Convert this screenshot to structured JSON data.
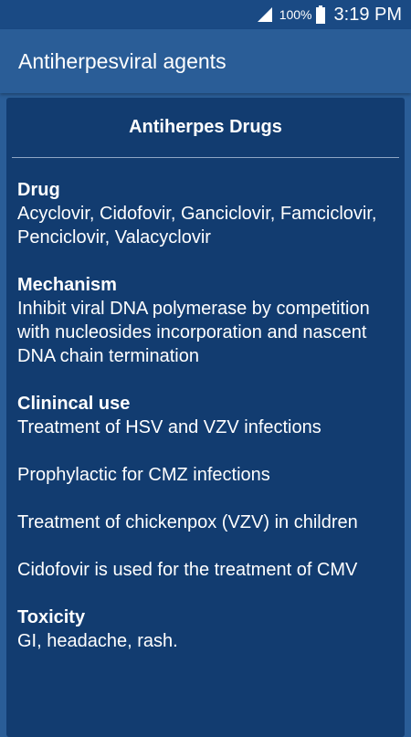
{
  "status_bar": {
    "battery_percent": "100%",
    "time": "3:19 PM",
    "icons": [
      "signal-icon",
      "battery-icon"
    ]
  },
  "app_bar": {
    "title": "Antiherpesviral agents"
  },
  "card": {
    "title": "Antiherpes Drugs",
    "sections": {
      "drug": {
        "label": "Drug",
        "text": "Acyclovir, Cidofovir, Ganciclovir, Famciclovir, Penciclovir, Valacyclovir"
      },
      "mechanism": {
        "label": "Mechanism",
        "text": "Inhibit viral DNA polymerase by competition with nucleosides incorporation and nascent DNA chain termination"
      },
      "clinical_use": {
        "label": "Clinincal use",
        "items": [
          "Treatment of HSV and VZV infections",
          "Prophylactic for CMZ infections",
          "Treatment of chickenpox (VZV) in children",
          "Cidofovir is used for the treatment of CMV"
        ]
      },
      "toxicity": {
        "label": "Toxicity",
        "text": "GI, headache, rash."
      }
    }
  },
  "colors": {
    "background": "#2a5d97",
    "status_bar": "#1a4a84",
    "card": "#123c70",
    "text": "#ffffff"
  }
}
